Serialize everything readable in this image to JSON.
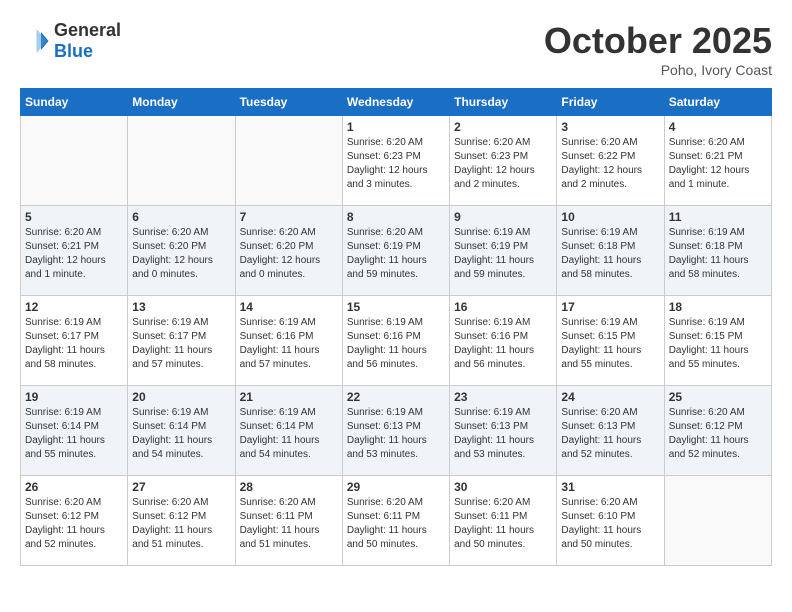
{
  "header": {
    "logo_general": "General",
    "logo_blue": "Blue",
    "month": "October 2025",
    "location": "Poho, Ivory Coast"
  },
  "weekdays": [
    "Sunday",
    "Monday",
    "Tuesday",
    "Wednesday",
    "Thursday",
    "Friday",
    "Saturday"
  ],
  "weeks": [
    [
      {
        "day": "",
        "info": ""
      },
      {
        "day": "",
        "info": ""
      },
      {
        "day": "",
        "info": ""
      },
      {
        "day": "1",
        "info": "Sunrise: 6:20 AM\nSunset: 6:23 PM\nDaylight: 12 hours and 3 minutes."
      },
      {
        "day": "2",
        "info": "Sunrise: 6:20 AM\nSunset: 6:23 PM\nDaylight: 12 hours and 2 minutes."
      },
      {
        "day": "3",
        "info": "Sunrise: 6:20 AM\nSunset: 6:22 PM\nDaylight: 12 hours and 2 minutes."
      },
      {
        "day": "4",
        "info": "Sunrise: 6:20 AM\nSunset: 6:21 PM\nDaylight: 12 hours and 1 minute."
      }
    ],
    [
      {
        "day": "5",
        "info": "Sunrise: 6:20 AM\nSunset: 6:21 PM\nDaylight: 12 hours and 1 minute."
      },
      {
        "day": "6",
        "info": "Sunrise: 6:20 AM\nSunset: 6:20 PM\nDaylight: 12 hours and 0 minutes."
      },
      {
        "day": "7",
        "info": "Sunrise: 6:20 AM\nSunset: 6:20 PM\nDaylight: 12 hours and 0 minutes."
      },
      {
        "day": "8",
        "info": "Sunrise: 6:20 AM\nSunset: 6:19 PM\nDaylight: 11 hours and 59 minutes."
      },
      {
        "day": "9",
        "info": "Sunrise: 6:19 AM\nSunset: 6:19 PM\nDaylight: 11 hours and 59 minutes."
      },
      {
        "day": "10",
        "info": "Sunrise: 6:19 AM\nSunset: 6:18 PM\nDaylight: 11 hours and 58 minutes."
      },
      {
        "day": "11",
        "info": "Sunrise: 6:19 AM\nSunset: 6:18 PM\nDaylight: 11 hours and 58 minutes."
      }
    ],
    [
      {
        "day": "12",
        "info": "Sunrise: 6:19 AM\nSunset: 6:17 PM\nDaylight: 11 hours and 58 minutes."
      },
      {
        "day": "13",
        "info": "Sunrise: 6:19 AM\nSunset: 6:17 PM\nDaylight: 11 hours and 57 minutes."
      },
      {
        "day": "14",
        "info": "Sunrise: 6:19 AM\nSunset: 6:16 PM\nDaylight: 11 hours and 57 minutes."
      },
      {
        "day": "15",
        "info": "Sunrise: 6:19 AM\nSunset: 6:16 PM\nDaylight: 11 hours and 56 minutes."
      },
      {
        "day": "16",
        "info": "Sunrise: 6:19 AM\nSunset: 6:16 PM\nDaylight: 11 hours and 56 minutes."
      },
      {
        "day": "17",
        "info": "Sunrise: 6:19 AM\nSunset: 6:15 PM\nDaylight: 11 hours and 55 minutes."
      },
      {
        "day": "18",
        "info": "Sunrise: 6:19 AM\nSunset: 6:15 PM\nDaylight: 11 hours and 55 minutes."
      }
    ],
    [
      {
        "day": "19",
        "info": "Sunrise: 6:19 AM\nSunset: 6:14 PM\nDaylight: 11 hours and 55 minutes."
      },
      {
        "day": "20",
        "info": "Sunrise: 6:19 AM\nSunset: 6:14 PM\nDaylight: 11 hours and 54 minutes."
      },
      {
        "day": "21",
        "info": "Sunrise: 6:19 AM\nSunset: 6:14 PM\nDaylight: 11 hours and 54 minutes."
      },
      {
        "day": "22",
        "info": "Sunrise: 6:19 AM\nSunset: 6:13 PM\nDaylight: 11 hours and 53 minutes."
      },
      {
        "day": "23",
        "info": "Sunrise: 6:19 AM\nSunset: 6:13 PM\nDaylight: 11 hours and 53 minutes."
      },
      {
        "day": "24",
        "info": "Sunrise: 6:20 AM\nSunset: 6:13 PM\nDaylight: 11 hours and 52 minutes."
      },
      {
        "day": "25",
        "info": "Sunrise: 6:20 AM\nSunset: 6:12 PM\nDaylight: 11 hours and 52 minutes."
      }
    ],
    [
      {
        "day": "26",
        "info": "Sunrise: 6:20 AM\nSunset: 6:12 PM\nDaylight: 11 hours and 52 minutes."
      },
      {
        "day": "27",
        "info": "Sunrise: 6:20 AM\nSunset: 6:12 PM\nDaylight: 11 hours and 51 minutes."
      },
      {
        "day": "28",
        "info": "Sunrise: 6:20 AM\nSunset: 6:11 PM\nDaylight: 11 hours and 51 minutes."
      },
      {
        "day": "29",
        "info": "Sunrise: 6:20 AM\nSunset: 6:11 PM\nDaylight: 11 hours and 50 minutes."
      },
      {
        "day": "30",
        "info": "Sunrise: 6:20 AM\nSunset: 6:11 PM\nDaylight: 11 hours and 50 minutes."
      },
      {
        "day": "31",
        "info": "Sunrise: 6:20 AM\nSunset: 6:10 PM\nDaylight: 11 hours and 50 minutes."
      },
      {
        "day": "",
        "info": ""
      }
    ]
  ]
}
